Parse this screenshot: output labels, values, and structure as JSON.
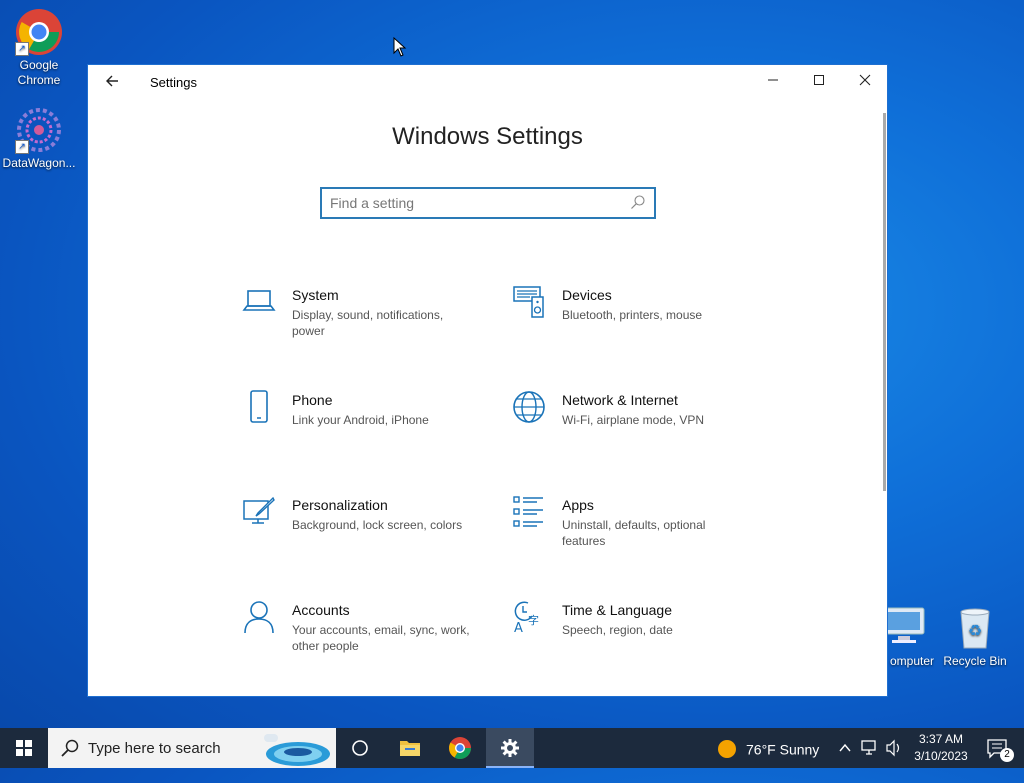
{
  "desktop": {
    "icons": [
      {
        "label": "Google Chrome"
      },
      {
        "label": "DataWagon..."
      },
      {
        "label": "omputer"
      },
      {
        "label": "Recycle Bin"
      }
    ]
  },
  "window": {
    "title": "Settings",
    "heading": "Windows Settings",
    "search_placeholder": "Find a setting",
    "tiles": [
      {
        "name": "System",
        "desc": "Display, sound, notifications, power",
        "icon": "laptop-icon"
      },
      {
        "name": "Devices",
        "desc": "Bluetooth, printers, mouse",
        "icon": "devices-icon"
      },
      {
        "name": "Phone",
        "desc": "Link your Android, iPhone",
        "icon": "phone-icon"
      },
      {
        "name": "Network & Internet",
        "desc": "Wi-Fi, airplane mode, VPN",
        "icon": "globe-icon"
      },
      {
        "name": "Personalization",
        "desc": "Background, lock screen, colors",
        "icon": "brush-icon"
      },
      {
        "name": "Apps",
        "desc": "Uninstall, defaults, optional features",
        "icon": "apps-list-icon"
      },
      {
        "name": "Accounts",
        "desc": "Your accounts, email, sync, work, other people",
        "icon": "person-icon"
      },
      {
        "name": "Time & Language",
        "desc": "Speech, region, date",
        "icon": "time-language-icon"
      }
    ]
  },
  "taskbar": {
    "search_text": "Type here to search",
    "weather": "76°F  Sunny",
    "time": "3:37 AM",
    "date": "3/10/2023",
    "notifications": "2"
  },
  "colors": {
    "accent": "#0067c0",
    "icon_blue": "#1a73b8",
    "taskbar": "#1c2a3d"
  }
}
